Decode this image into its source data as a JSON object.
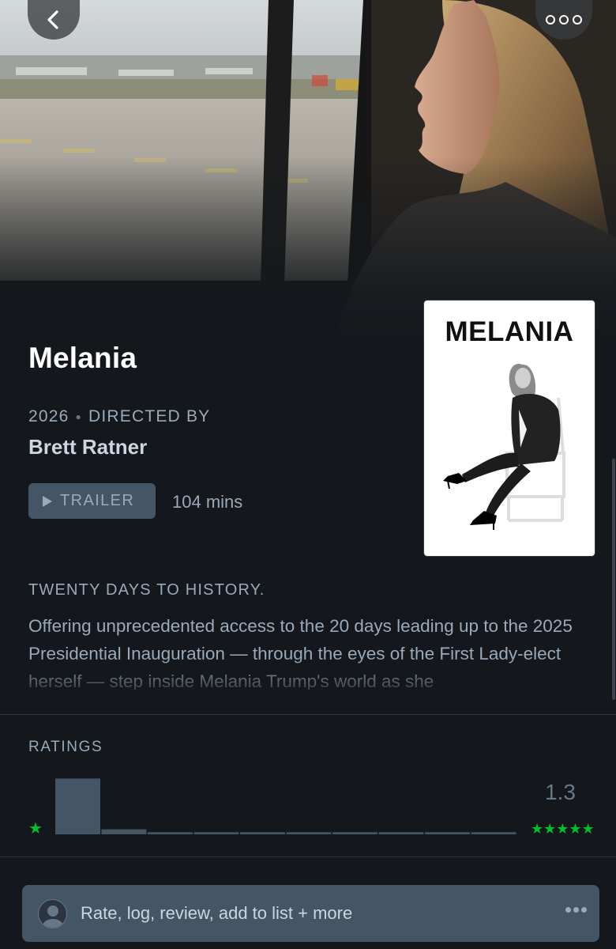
{
  "nav": {
    "back_icon": "chevron-left-icon",
    "more_icon": "ellipsis-icon"
  },
  "film": {
    "title": "Melania",
    "year": "2026",
    "directed_by_label": "DIRECTED BY",
    "director": "Brett Ratner",
    "trailer_label": "TRAILER",
    "runtime": "104 mins",
    "poster_title": "MELANIA",
    "tagline": "TWENTY DAYS TO HISTORY.",
    "synopsis": "Offering unprecedented access to the 20 days leading up to the 2025 Presidential Inauguration — through the eyes of the First Lady-elect herself — step inside Melania Trump's world as she"
  },
  "ratings": {
    "label": "RATINGS",
    "average": "1.3",
    "histogram": [
      0.78,
      0.07,
      0.03,
      0.03,
      0.03,
      0.03,
      0.03,
      0.03,
      0.03,
      0.03
    ],
    "min_stars": "★",
    "max_stars": "★★★★★"
  },
  "action_bar": {
    "label": "Rate, log, review, add to list + more",
    "avatar_icon": "user-avatar-icon",
    "more_icon": "ellipsis-icon"
  },
  "colors": {
    "background": "#14181c",
    "text_muted": "#99aabb",
    "button_bg": "#445566",
    "bar_color": "#445566",
    "star_green": "#00c030"
  }
}
